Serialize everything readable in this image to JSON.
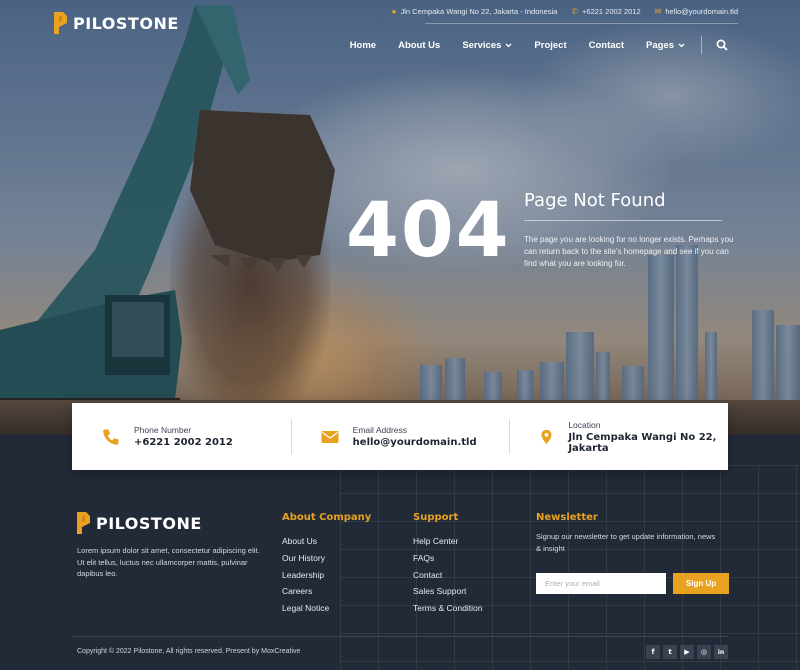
{
  "brand": {
    "name": "PILOSTONE",
    "accent": "#e9a21f"
  },
  "topbar": {
    "address": "Jln Cempaka Wangi No 22, Jakarta - Indonesia",
    "phone": "+6221 2002 2012",
    "email": "hello@yourdomain.tld"
  },
  "nav": {
    "items": [
      {
        "label": "Home",
        "dropdown": false
      },
      {
        "label": "About Us",
        "dropdown": false
      },
      {
        "label": "Services",
        "dropdown": true
      },
      {
        "label": "Project",
        "dropdown": false
      },
      {
        "label": "Contact",
        "dropdown": false
      },
      {
        "label": "Pages",
        "dropdown": true
      }
    ],
    "search_icon": "search-icon"
  },
  "error": {
    "code": "404",
    "title": "Page Not Found",
    "message": "The page you are looking for no longer exists. Perhaps you can return back to the site's homepage and see if you can find what you are looking for."
  },
  "contact_card": [
    {
      "icon": "phone-icon",
      "label": "Phone Number",
      "value": "+6221 2002 2012"
    },
    {
      "icon": "envelope-icon",
      "label": "Email Address",
      "value": "hello@yourdomain.tld"
    },
    {
      "icon": "location-pin-icon",
      "label": "Location",
      "value": "Jln Cempaka Wangi No 22, Jakarta"
    }
  ],
  "footer": {
    "description": "Lorem ipsum dolor sit amet, consectetur adipiscing elit. Ut elit tellus, luctus nec ullamcorper mattis, pulvinar dapibus leo.",
    "about": {
      "title": "About Company",
      "links": [
        "About Us",
        "Our History",
        "Leadership",
        "Careers",
        "Legal Notice"
      ]
    },
    "support": {
      "title": "Support",
      "links": [
        "Help Center",
        "FAQs",
        "Contact",
        "Sales Support",
        "Terms & Condition"
      ]
    },
    "newsletter": {
      "title": "Newsletter",
      "text": "Signup our newsletter to get update information, news & insight",
      "placeholder": "Enter your email",
      "button": "Sign Up"
    },
    "copyright": "Copyright © 2022 Pilostone, All rights reserved. Present by MoxCreative",
    "social": [
      {
        "icon": "facebook-icon",
        "glyph": "f"
      },
      {
        "icon": "twitter-icon",
        "glyph": "t"
      },
      {
        "icon": "youtube-icon",
        "glyph": "▶"
      },
      {
        "icon": "instagram-icon",
        "glyph": "◎"
      },
      {
        "icon": "linkedin-icon",
        "glyph": "in"
      }
    ]
  }
}
